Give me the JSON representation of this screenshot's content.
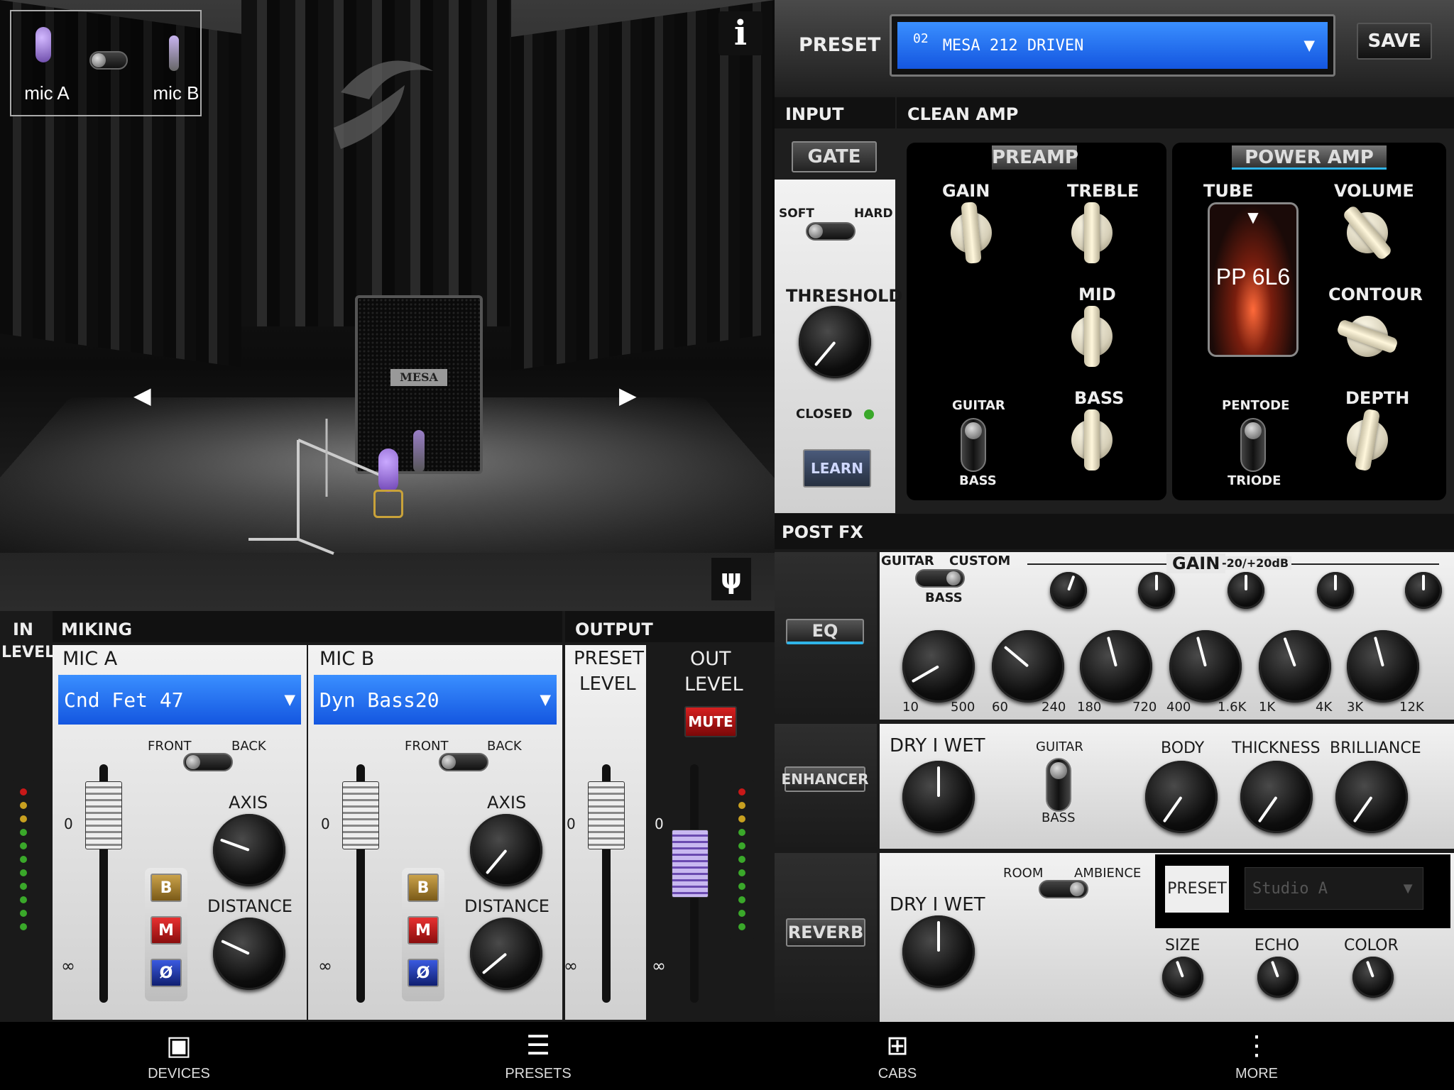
{
  "studio": {
    "mic_a_label": "mic A",
    "mic_b_label": "mic B",
    "info_label": "i",
    "cab_brand": "MESA"
  },
  "preset_bar": {
    "label": "PRESET",
    "number": "02",
    "name": "MESA 212 DRIVEN",
    "save_label": "SAVE"
  },
  "input": {
    "header": "INPUT",
    "gate_label": "GATE",
    "soft_label": "SOFT",
    "hard_label": "HARD",
    "threshold_label": "THRESHOLD",
    "closed_label": "CLOSED",
    "learn_label": "LEARN"
  },
  "clean_amp": {
    "header": "CLEAN AMP",
    "preamp_label": "PREAMP",
    "gain_label": "GAIN",
    "treble_label": "TREBLE",
    "mid_label": "MID",
    "bass_label": "BASS",
    "guitar_label": "GUITAR",
    "bass_switch_label": "BASS",
    "power_amp_label": "POWER AMP",
    "tube_label": "TUBE",
    "tube_type": "PP 6L6",
    "volume_label": "VOLUME",
    "contour_label": "CONTOUR",
    "depth_label": "DEPTH",
    "pentode_label": "PENTODE",
    "triode_label": "TRIODE"
  },
  "post_fx": {
    "header": "POST FX",
    "eq": {
      "label": "EQ",
      "guitar_label": "GUITAR",
      "custom_label": "CUSTOM",
      "bass_label": "BASS",
      "gain_label": "GAIN",
      "gain_range": "-20/+20dB",
      "band_ranges": [
        {
          "lo": "10",
          "hi": "500"
        },
        {
          "lo": "60",
          "hi": "240"
        },
        {
          "lo": "180",
          "hi": "720"
        },
        {
          "lo": "400",
          "hi": "1.6K"
        },
        {
          "lo": "1K",
          "hi": "4K"
        },
        {
          "lo": "3K",
          "hi": "12K"
        }
      ]
    },
    "enhancer": {
      "label": "ENHANCER",
      "dry_wet_label": "DRY I WET",
      "guitar_label": "GUITAR",
      "bass_label": "BASS",
      "body_label": "BODY",
      "thickness_label": "THICKNESS",
      "brilliance_label": "BRILLIANCE"
    },
    "reverb": {
      "label": "REVERB",
      "dry_wet_label": "DRY I WET",
      "room_label": "ROOM",
      "ambience_label": "AMBIENCE",
      "preset_label": "PRESET",
      "preset_value": "Studio A",
      "size_label": "SIZE",
      "echo_label": "ECHO",
      "color_label": "COLOR"
    }
  },
  "miking": {
    "in_label": "IN",
    "level_label": "LEVEL",
    "header": "MIKING",
    "mic_a": {
      "title": "MIC A",
      "model": "Cnd Fet 47",
      "front_label": "FRONT",
      "back_label": "BACK",
      "axis_label": "AXIS",
      "distance_label": "DISTANCE",
      "b_label": "B",
      "m_label": "M",
      "phase_label": "Ø",
      "zero_label": "0",
      "inf_label": "∞"
    },
    "mic_b": {
      "title": "MIC B",
      "model": "Dyn Bass20",
      "front_label": "FRONT",
      "back_label": "BACK",
      "axis_label": "AXIS",
      "distance_label": "DISTANCE",
      "b_label": "B",
      "m_label": "M",
      "phase_label": "Ø",
      "zero_label": "0",
      "inf_label": "∞"
    }
  },
  "output": {
    "header": "OUTPUT",
    "preset_level_line1": "PRESET",
    "preset_level_line2": "LEVEL",
    "out_level_line1": "OUT",
    "out_level_line2": "LEVEL",
    "mute_label": "MUTE",
    "zero_label": "0",
    "inf_label": "∞"
  },
  "nav": {
    "devices": "DEVICES",
    "presets": "PRESETS",
    "cabs": "CABS",
    "more": "MORE"
  },
  "colors": {
    "select_blue": "#1f6df0",
    "accent_cyan": "#2fb4e8",
    "mute_red": "#c81818",
    "led_green": "#3aa82a"
  }
}
